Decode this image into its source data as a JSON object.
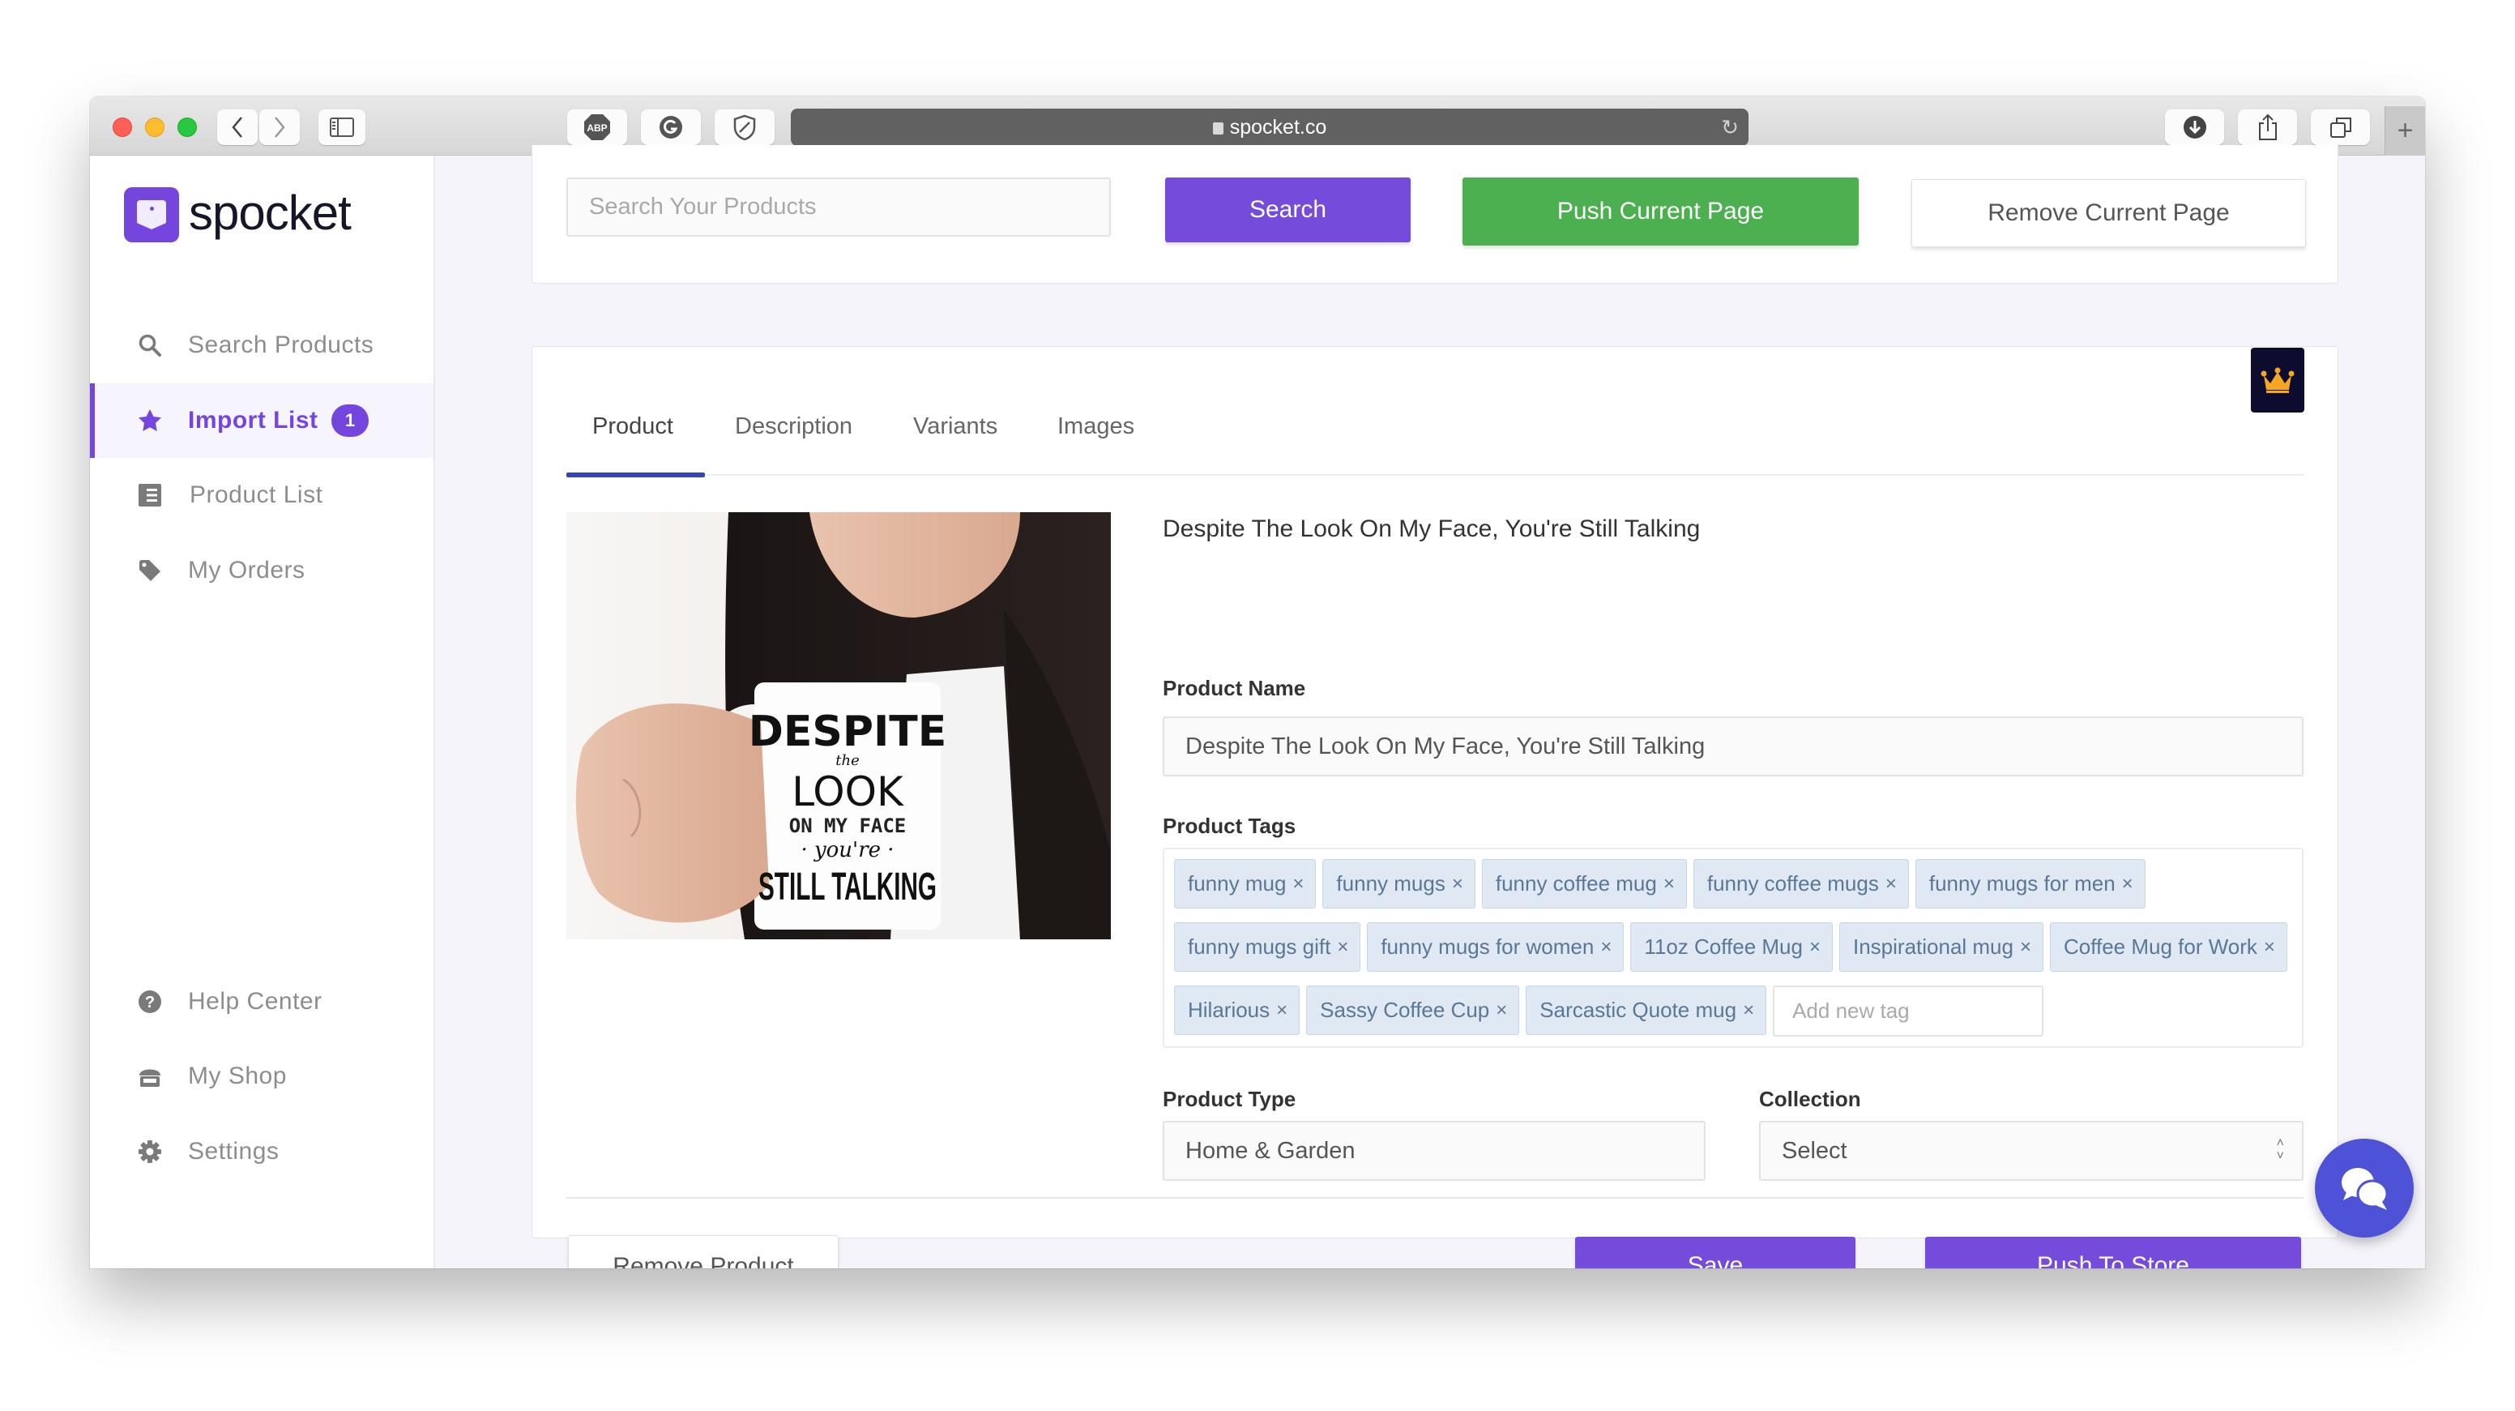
{
  "browser": {
    "url": "spocket.co",
    "toolbar_icons": [
      "back-icon",
      "forward-icon",
      "sidebar-icon",
      "adblock-plus-icon",
      "grammarly-icon",
      "shield-icon",
      "download-icon",
      "share-icon",
      "tabs-icon",
      "new-tab-icon"
    ],
    "abp_label": "ABP",
    "new_tab_label": "+"
  },
  "sidebar": {
    "logo_text": "spocket",
    "items": [
      {
        "label": "Search Products",
        "icon": "search-icon",
        "active": false
      },
      {
        "label": "Import List",
        "icon": "star-icon",
        "active": true,
        "badge": "1"
      },
      {
        "label": "Product List",
        "icon": "list-icon",
        "active": false
      },
      {
        "label": "My Orders",
        "icon": "tag-icon",
        "active": false
      }
    ],
    "bottom_items": [
      {
        "label": "Help Center",
        "icon": "question-circle-icon"
      },
      {
        "label": "My Shop",
        "icon": "shop-icon"
      },
      {
        "label": "Settings",
        "icon": "gear-icon"
      }
    ]
  },
  "toolbar": {
    "search_placeholder": "Search Your Products",
    "search_label": "Search",
    "push_page_label": "Push Current Page",
    "remove_page_label": "Remove Current Page"
  },
  "product": {
    "tabs": [
      "Product",
      "Description",
      "Variants",
      "Images"
    ],
    "active_tab": "Product",
    "title": "Despite The Look On My Face, You're Still Talking",
    "image_alt": "Woman holding white mug reading DESPITE the LOOK ON MY FACE YOU'RE STILL TALKING",
    "mug_text": [
      "DESPITE",
      "the",
      "LOOK",
      "ON MY FACE",
      "· you're ·",
      "STILL TALKING"
    ],
    "name_label": "Product Name",
    "name_value": "Despite The Look On My Face, You're Still Talking",
    "tags_label": "Product Tags",
    "tags": [
      "funny mug",
      "funny mugs",
      "funny coffee mug",
      "funny coffee mugs",
      "funny mugs for men",
      "funny mugs gift",
      "funny mugs for women",
      "11oz Coffee Mug",
      "Inspirational mug",
      "Coffee Mug for Work",
      "Hilarious",
      "Sassy Coffee Cup",
      "Sarcastic Quote mug"
    ],
    "tag_remove_symbol": "×",
    "add_tag_placeholder": "Add new tag",
    "type_label": "Product Type",
    "type_value": "Home & Garden",
    "collection_label": "Collection",
    "collection_value": "Select",
    "remove_label": "Remove Product",
    "save_label": "Save",
    "push_label": "Push To Store"
  },
  "colors": {
    "brand": "#754bdb",
    "green": "#4caf50",
    "tag_bg": "#dfe8f3",
    "crown_bg": "#0c0c2e",
    "crown": "#f5a623",
    "chat": "#4e52d6"
  }
}
